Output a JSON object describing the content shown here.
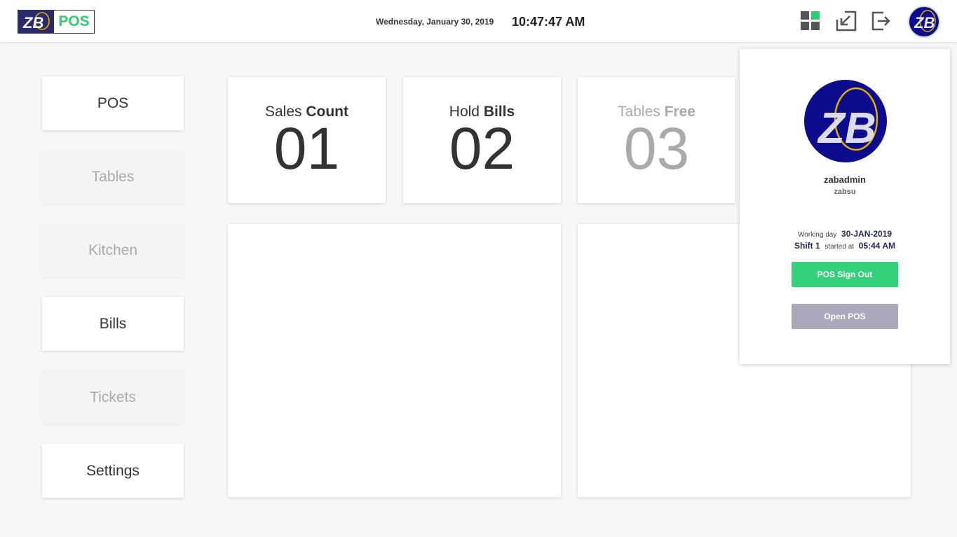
{
  "header": {
    "logo_text": "POS",
    "logo_mark": "ZB",
    "date": "Wednesday, January 30, 2019",
    "time": "10:47:47 AM",
    "icons": [
      "dashboard-grid-icon",
      "minimize-window-icon",
      "exit-icon",
      "user-avatar-icon"
    ]
  },
  "sidebar": {
    "items": [
      {
        "label": "POS",
        "enabled": true
      },
      {
        "label": "Tables",
        "enabled": false
      },
      {
        "label": "Kitchen",
        "enabled": false
      },
      {
        "label": "Bills",
        "enabled": true
      },
      {
        "label": "Tickets",
        "enabled": false
      },
      {
        "label": "Settings",
        "enabled": true
      }
    ]
  },
  "stats": [
    {
      "label_light": "Sales",
      "label_bold": "Count",
      "value": "01"
    },
    {
      "label_light": "Hold",
      "label_bold": "Bills",
      "value": "02"
    },
    {
      "label_light": "Tables",
      "label_bold": "Free",
      "value": "03"
    }
  ],
  "profile": {
    "username": "zabadmin",
    "group": "zabsu",
    "working_day_label": "Working day",
    "working_day": "30-JAN-2019",
    "shift": "Shift 1",
    "started_label": "started at",
    "started_time": "05:44 AM",
    "sign_out_label": "POS Sign Out",
    "open_pos_label": "Open POS"
  },
  "colors": {
    "accent_green": "#33d17a",
    "brand_navy": "#0c0c8c",
    "disabled_button": "#aba8bc"
  }
}
